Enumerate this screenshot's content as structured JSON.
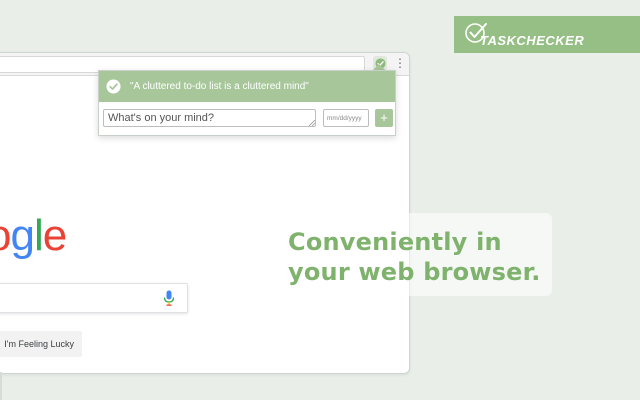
{
  "brand": {
    "name": "TASKCHECKER",
    "color": "#95bf84",
    "icon": "check-circle-icon"
  },
  "browser": {
    "google_logo": [
      "o",
      "g",
      "l",
      "e"
    ],
    "google_colors": [
      "#ea4335",
      "#4285f4",
      "#34a853",
      "#ea4335"
    ],
    "lucky_label": "I'm Feeling Lucky",
    "icons": [
      "extension-check-icon",
      "more-vert-icon",
      "microphone-icon"
    ]
  },
  "popup": {
    "quote": "\"A cluttered to-do list is a cluttered mind\"",
    "task_placeholder": "What's on your mind?",
    "date_placeholder": "mm/dd/yyyy",
    "add_label": "+",
    "accent": "#a7c79a"
  },
  "tagline": {
    "line1": "Conveniently in",
    "line2": "your web browser.",
    "color": "#7fb26c"
  }
}
